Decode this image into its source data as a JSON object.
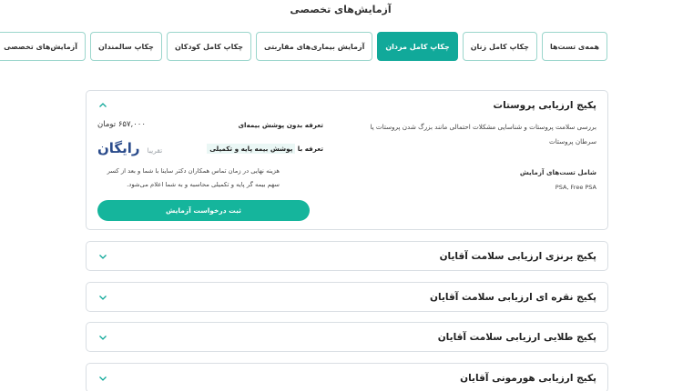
{
  "page_title": "آزمایش‌های تخصصی",
  "tabs": [
    {
      "label": "همه‌ی تست‌ها",
      "active": false
    },
    {
      "label": "چکاپ کامل زنان",
      "active": false
    },
    {
      "label": "چکاپ کامل مردان",
      "active": true
    },
    {
      "label": "آزمایش بیماری‌های مقاربتی",
      "active": false
    },
    {
      "label": "چکاپ کامل کودکان",
      "active": false
    },
    {
      "label": "چکاپ سالمندان",
      "active": false
    },
    {
      "label": "آزمایش‌های تخصصی",
      "active": false
    }
  ],
  "expanded_package": {
    "title": "پکیج ارزیابی پروستات",
    "description": "بررسی سلامت پروستات و شناسایی مشکلات احتمالی مانند بزرگ شدن پروستات یا سرطان پروستات",
    "tests_label": "شامل تست‌های آزمایش",
    "tests_value": "PSA, Free PSA",
    "price_label": "تعرفه بدون پوشش بیمه‌ای",
    "price_value": "۶۵۷,۰۰۰ تومان",
    "insurance_label_prefix": "تعرفه با",
    "insurance_label_highlight": "پوشش بیمه پایه و تکمیلی",
    "approx_label": "تقریبا",
    "free_label": "رایگان",
    "note": "هزینه نهایی در زمان تماس همکاران دکتر ساینا با شما و بعد از کسر سهم بیمه گر پایه و تکمیلی محاسبه و به شما اعلام می‌شود.",
    "cta_label": "ثبت درخواست آزمایش"
  },
  "collapsed_packages": [
    {
      "title": "پکیج برنزی ارزیابی سلامت آقایان"
    },
    {
      "title": "پکیج نقره ای ارزیابی سلامت آقایان"
    },
    {
      "title": "پکیج طلایی ارزیابی سلامت آقایان"
    },
    {
      "title": "پکیج ارزیابی هورمونی آقایان"
    }
  ],
  "colors": {
    "accent": "#11a99a",
    "free_text": "#2b4c8c",
    "border": "#d9dee3"
  }
}
